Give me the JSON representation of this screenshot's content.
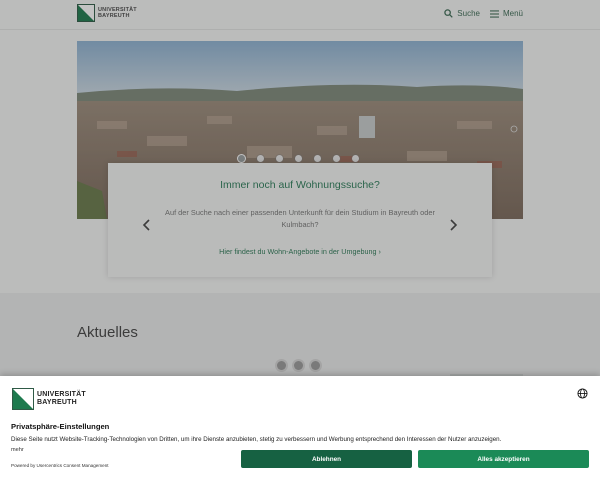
{
  "header": {
    "logo_line1": "UNIVERSITÄT",
    "logo_line2": "BAYREUTH",
    "search_label": "Suche",
    "menu_label": "Menü"
  },
  "hero": {
    "slide_count": 7,
    "active_slide": 1
  },
  "card": {
    "title": "Immer noch auf Wohnungssuche?",
    "body": "Auf der Suche nach einer passenden Unterkunft für dein Studium in Bayreuth oder Kulmbach?",
    "link": "Hier findest du Wohn-Angebote in der Umgebung ›"
  },
  "news": {
    "title": "Aktuelles"
  },
  "consent": {
    "logo_line1": "UNIVERSITÄT",
    "logo_line2": "BAYREUTH",
    "title": "Privatsphäre-Einstellungen",
    "description": "Diese Seite nutzt Website-Tracking-Technologien von Dritten, um ihre Dienste anzubieten, stetig zu verbessern und Werbung entsprechend den Interessen der Nutzer anzuzeigen.",
    "more": "mehr",
    "powered_by": "Powered by Usercentrics Consent Management",
    "decline_label": "Ablehnen",
    "accept_label": "Alles akzeptieren"
  },
  "colors": {
    "brand_green": "#1b8a57",
    "brand_dark_green": "#166142"
  }
}
